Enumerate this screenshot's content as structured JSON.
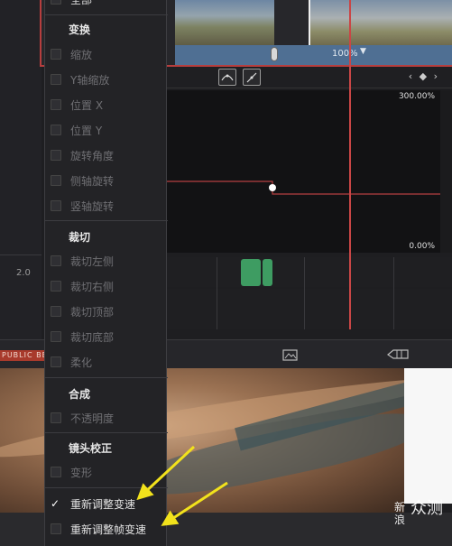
{
  "ruler": {
    "value": "2.0"
  },
  "clip_strip": {
    "zoom": "100%",
    "caret": "▼"
  },
  "graph": {
    "top_label": "300.00%",
    "bottom_label": "0.00%",
    "kf_nav": "‹ ◆ ›"
  },
  "toolbar": {
    "brand_text": "PUBLIC BE"
  },
  "watermark": {
    "line1": "新",
    "line2": "浪",
    "main": "众测"
  },
  "menu": {
    "item_top": "全部",
    "transform": {
      "header": "变换",
      "items": [
        "缩放",
        "Y轴缩放",
        "位置 X",
        "位置 Y",
        "旋转角度",
        "侧轴旋转",
        "竖轴旋转"
      ]
    },
    "crop": {
      "header": "裁切",
      "items": [
        "裁切左侧",
        "裁切右侧",
        "裁切顶部",
        "裁切底部",
        "柔化"
      ]
    },
    "composite": {
      "header": "合成",
      "items": [
        "不透明度"
      ]
    },
    "lens": {
      "header": "镜头校正",
      "items": [
        "变形"
      ]
    },
    "retime_speed": {
      "label": "重新调整变速",
      "checked": true
    },
    "retime_frame": {
      "label": "重新调整帧变速",
      "checked": false
    }
  },
  "colors": {
    "accent_red": "#c94646",
    "arrow_yellow": "#f2e21c",
    "keyframe_green": "#3e9c62"
  }
}
